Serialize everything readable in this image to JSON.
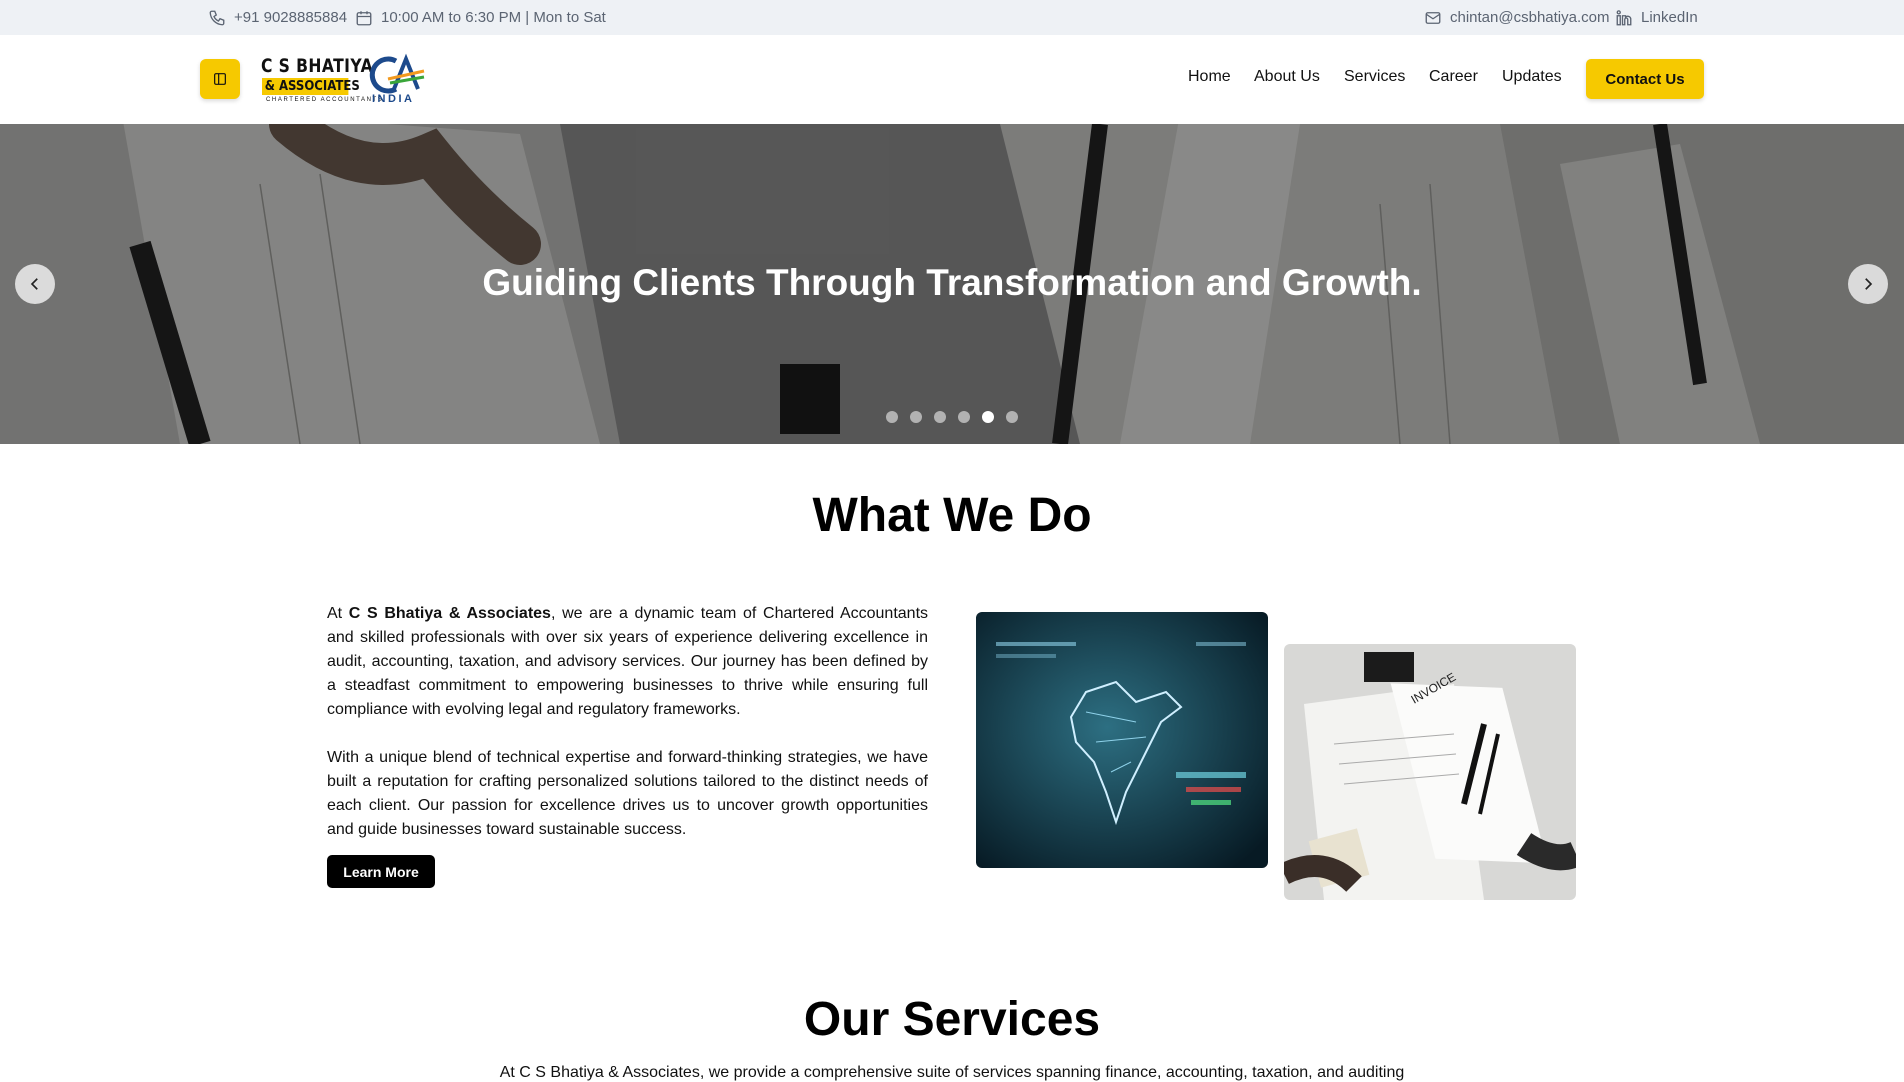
{
  "topbar": {
    "phone": "+91 9028885884",
    "hours": "10:00 AM to 6:30 PM | Mon to Sat",
    "email": "chintan@csbhatiya.com",
    "linkedin": "LinkedIn"
  },
  "header": {
    "logo": {
      "line1": "C S BHATIYA",
      "line2": "& ASSOCIATES",
      "line3": "CHARTERED ACCOUNTANTS",
      "ca_mark": "CA",
      "ca_sub": "INDIA"
    },
    "nav": [
      "Home",
      "About Us",
      "Services",
      "Career",
      "Updates"
    ],
    "contact_button": "Contact Us"
  },
  "hero": {
    "title": "Guiding Clients Through Transformation and Growth.",
    "slide_count": 6,
    "active_slide": 5
  },
  "what_we_do": {
    "title": "What We Do",
    "para1_prefix": "At ",
    "para1_bold": "C S Bhatiya & Associates",
    "para1_rest": ", we are a dynamic team of Chartered Accountants and skilled professionals with over six years of experience delivering excellence in audit, accounting, taxation, and advisory services. Our journey has been defined by a steadfast commitment to empowering businesses to thrive while ensuring full compliance with evolving legal and regulatory frameworks.",
    "para2": "With a unique blend of technical expertise and forward-thinking strategies, we have built a reputation for crafting personalized solutions tailored to the distinct needs of each client. Our passion for excellence drives us to uncover growth opportunities and guide businesses toward sustainable success.",
    "learn_more": "Learn More",
    "image1_text": "INVOICE"
  },
  "services": {
    "title": "Our Services",
    "intro": "At C S Bhatiya & Associates, we provide a comprehensive suite of services spanning finance, accounting, taxation, and auditing"
  },
  "colors": {
    "accent": "#f6c900",
    "topbar_bg": "#eef1f5",
    "topbar_text": "#5b6472"
  }
}
